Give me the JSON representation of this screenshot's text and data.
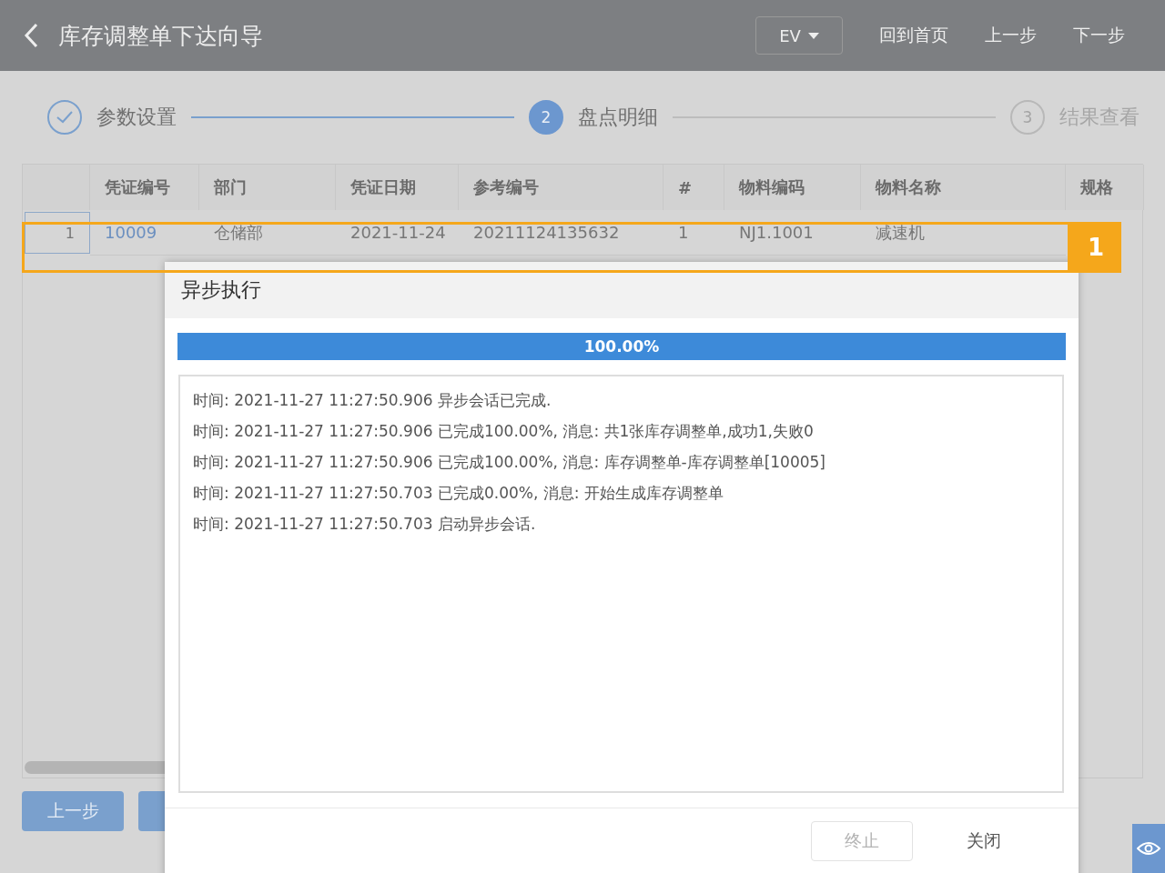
{
  "header": {
    "title": "库存调整单下达向导",
    "dropdown": "EV",
    "buttons": [
      "回到首页",
      "上一步",
      "下一步"
    ]
  },
  "steps": [
    {
      "label": "参数设置",
      "completed": true,
      "selected": false
    },
    {
      "number": "2",
      "label": "盘点明细",
      "completed": false,
      "selected": true
    },
    {
      "number": "3",
      "label": "结果查看",
      "completed": false,
      "selected": false
    }
  ],
  "table": {
    "columns": [
      "凭证编号",
      "部门",
      "凭证日期",
      "参考编号",
      "#",
      "物料编码",
      "物料名称",
      "规格"
    ],
    "rows": [
      {
        "index": "1",
        "cells": [
          "10009",
          "仓储部",
          "2021-11-24",
          "20211124135632",
          "1",
          "NJ1.1001",
          "减速机"
        ]
      }
    ]
  },
  "footer_buttons": [
    "上一步"
  ],
  "annotation": {
    "label": "1"
  },
  "dialog": {
    "title": "异步执行",
    "progress": {
      "level": 1,
      "reading": "100.00%"
    },
    "log": [
      "时间: 2021-11-27 11:27:50.906 异步会话已完成.",
      "时间: 2021-11-27 11:27:50.906 已完成100.00%, 消息: 共1张库存调整单,成功1,失败0",
      "时间: 2021-11-27 11:27:50.906 已完成100.00%, 消息: 库存调整单-库存调整单[10005]",
      "时间: 2021-11-27 11:27:50.703 已完成0.00%, 消息: 开始生成库存调整单",
      "时间: 2021-11-27 11:27:50.703 启动异步会话."
    ],
    "buttons": [
      {
        "label": "终止",
        "disabled": true
      },
      {
        "label": "关闭",
        "disabled": false
      }
    ]
  }
}
